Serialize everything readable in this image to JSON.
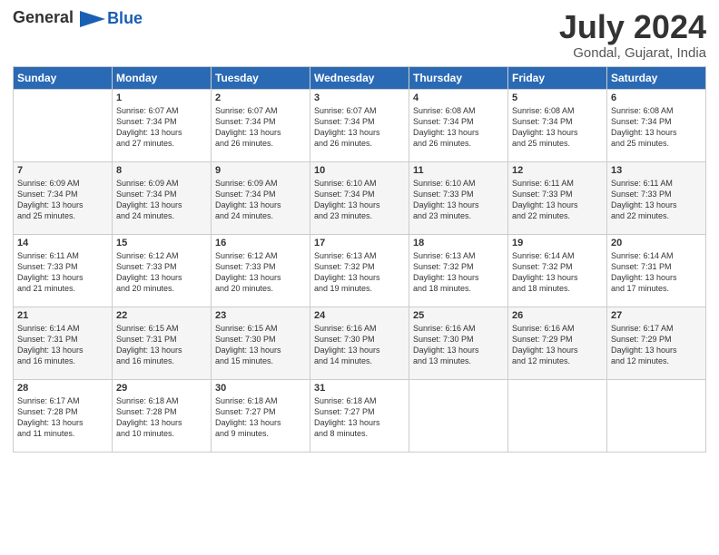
{
  "header": {
    "logo_general": "General",
    "logo_blue": "Blue",
    "month_title": "July 2024",
    "location": "Gondal, Gujarat, India"
  },
  "weekdays": [
    "Sunday",
    "Monday",
    "Tuesday",
    "Wednesday",
    "Thursday",
    "Friday",
    "Saturday"
  ],
  "weeks": [
    [
      {
        "day": "",
        "content": ""
      },
      {
        "day": "1",
        "content": "Sunrise: 6:07 AM\nSunset: 7:34 PM\nDaylight: 13 hours\nand 27 minutes."
      },
      {
        "day": "2",
        "content": "Sunrise: 6:07 AM\nSunset: 7:34 PM\nDaylight: 13 hours\nand 26 minutes."
      },
      {
        "day": "3",
        "content": "Sunrise: 6:07 AM\nSunset: 7:34 PM\nDaylight: 13 hours\nand 26 minutes."
      },
      {
        "day": "4",
        "content": "Sunrise: 6:08 AM\nSunset: 7:34 PM\nDaylight: 13 hours\nand 26 minutes."
      },
      {
        "day": "5",
        "content": "Sunrise: 6:08 AM\nSunset: 7:34 PM\nDaylight: 13 hours\nand 25 minutes."
      },
      {
        "day": "6",
        "content": "Sunrise: 6:08 AM\nSunset: 7:34 PM\nDaylight: 13 hours\nand 25 minutes."
      }
    ],
    [
      {
        "day": "7",
        "content": "Sunrise: 6:09 AM\nSunset: 7:34 PM\nDaylight: 13 hours\nand 25 minutes."
      },
      {
        "day": "8",
        "content": "Sunrise: 6:09 AM\nSunset: 7:34 PM\nDaylight: 13 hours\nand 24 minutes."
      },
      {
        "day": "9",
        "content": "Sunrise: 6:09 AM\nSunset: 7:34 PM\nDaylight: 13 hours\nand 24 minutes."
      },
      {
        "day": "10",
        "content": "Sunrise: 6:10 AM\nSunset: 7:34 PM\nDaylight: 13 hours\nand 23 minutes."
      },
      {
        "day": "11",
        "content": "Sunrise: 6:10 AM\nSunset: 7:33 PM\nDaylight: 13 hours\nand 23 minutes."
      },
      {
        "day": "12",
        "content": "Sunrise: 6:11 AM\nSunset: 7:33 PM\nDaylight: 13 hours\nand 22 minutes."
      },
      {
        "day": "13",
        "content": "Sunrise: 6:11 AM\nSunset: 7:33 PM\nDaylight: 13 hours\nand 22 minutes."
      }
    ],
    [
      {
        "day": "14",
        "content": "Sunrise: 6:11 AM\nSunset: 7:33 PM\nDaylight: 13 hours\nand 21 minutes."
      },
      {
        "day": "15",
        "content": "Sunrise: 6:12 AM\nSunset: 7:33 PM\nDaylight: 13 hours\nand 20 minutes."
      },
      {
        "day": "16",
        "content": "Sunrise: 6:12 AM\nSunset: 7:33 PM\nDaylight: 13 hours\nand 20 minutes."
      },
      {
        "day": "17",
        "content": "Sunrise: 6:13 AM\nSunset: 7:32 PM\nDaylight: 13 hours\nand 19 minutes."
      },
      {
        "day": "18",
        "content": "Sunrise: 6:13 AM\nSunset: 7:32 PM\nDaylight: 13 hours\nand 18 minutes."
      },
      {
        "day": "19",
        "content": "Sunrise: 6:14 AM\nSunset: 7:32 PM\nDaylight: 13 hours\nand 18 minutes."
      },
      {
        "day": "20",
        "content": "Sunrise: 6:14 AM\nSunset: 7:31 PM\nDaylight: 13 hours\nand 17 minutes."
      }
    ],
    [
      {
        "day": "21",
        "content": "Sunrise: 6:14 AM\nSunset: 7:31 PM\nDaylight: 13 hours\nand 16 minutes."
      },
      {
        "day": "22",
        "content": "Sunrise: 6:15 AM\nSunset: 7:31 PM\nDaylight: 13 hours\nand 16 minutes."
      },
      {
        "day": "23",
        "content": "Sunrise: 6:15 AM\nSunset: 7:30 PM\nDaylight: 13 hours\nand 15 minutes."
      },
      {
        "day": "24",
        "content": "Sunrise: 6:16 AM\nSunset: 7:30 PM\nDaylight: 13 hours\nand 14 minutes."
      },
      {
        "day": "25",
        "content": "Sunrise: 6:16 AM\nSunset: 7:30 PM\nDaylight: 13 hours\nand 13 minutes."
      },
      {
        "day": "26",
        "content": "Sunrise: 6:16 AM\nSunset: 7:29 PM\nDaylight: 13 hours\nand 12 minutes."
      },
      {
        "day": "27",
        "content": "Sunrise: 6:17 AM\nSunset: 7:29 PM\nDaylight: 13 hours\nand 12 minutes."
      }
    ],
    [
      {
        "day": "28",
        "content": "Sunrise: 6:17 AM\nSunset: 7:28 PM\nDaylight: 13 hours\nand 11 minutes."
      },
      {
        "day": "29",
        "content": "Sunrise: 6:18 AM\nSunset: 7:28 PM\nDaylight: 13 hours\nand 10 minutes."
      },
      {
        "day": "30",
        "content": "Sunrise: 6:18 AM\nSunset: 7:27 PM\nDaylight: 13 hours\nand 9 minutes."
      },
      {
        "day": "31",
        "content": "Sunrise: 6:18 AM\nSunset: 7:27 PM\nDaylight: 13 hours\nand 8 minutes."
      },
      {
        "day": "",
        "content": ""
      },
      {
        "day": "",
        "content": ""
      },
      {
        "day": "",
        "content": ""
      }
    ]
  ]
}
